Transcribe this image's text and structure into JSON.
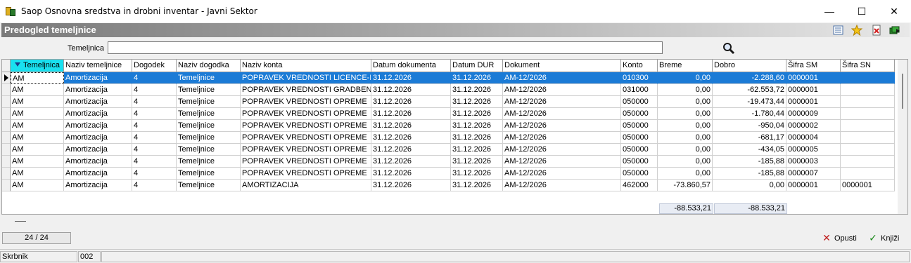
{
  "window": {
    "title": "Saop Osnovna sredstva in drobni inventar - Javni Sektor",
    "minimize": "—",
    "maximize": "☐",
    "close": "✕"
  },
  "header": {
    "title": "Predogled temeljnice",
    "icons": [
      "list-settings-icon",
      "favorite-star-icon",
      "delete-document-icon",
      "export-books-icon"
    ]
  },
  "search": {
    "label": "Temeljnica",
    "value": "",
    "icon": "search-icon"
  },
  "grid": {
    "columns": [
      "Temeljnica",
      "Naziv temeljnice",
      "Dogodek",
      "Naziv dogodka",
      "Naziv konta",
      "Datum dokumenta",
      "Datum DUR",
      "Dokument",
      "Konto",
      "Breme",
      "Dobro",
      "Šifra SM",
      "Šifra SN"
    ],
    "sorted_column": "Temeljnica",
    "rows": [
      [
        "AM",
        "Amortizacija",
        "4",
        "Temeljnice",
        "POPRAVEK VREDNOSTI LICENCE-Prog",
        "31.12.2026",
        "31.12.2026",
        "AM-12/2026",
        "010300",
        "0,00",
        "-2.288,60",
        "0000001",
        ""
      ],
      [
        "AM",
        "Amortizacija",
        "4",
        "Temeljnice",
        "POPRAVEK VREDNOSTI GRADBENIH O",
        "31.12.2026",
        "31.12.2026",
        "AM-12/2026",
        "031000",
        "0,00",
        "-62.553,72",
        "0000001",
        ""
      ],
      [
        "AM",
        "Amortizacija",
        "4",
        "Temeljnice",
        "POPRAVEK VREDNOSTI OPREME",
        "31.12.2026",
        "31.12.2026",
        "AM-12/2026",
        "050000",
        "0,00",
        "-19.473,44",
        "0000001",
        ""
      ],
      [
        "AM",
        "Amortizacija",
        "4",
        "Temeljnice",
        "POPRAVEK VREDNOSTI OPREME",
        "31.12.2026",
        "31.12.2026",
        "AM-12/2026",
        "050000",
        "0,00",
        "-1.780,44",
        "0000009",
        ""
      ],
      [
        "AM",
        "Amortizacija",
        "4",
        "Temeljnice",
        "POPRAVEK VREDNOSTI OPREME",
        "31.12.2026",
        "31.12.2026",
        "AM-12/2026",
        "050000",
        "0,00",
        "-950,04",
        "0000002",
        ""
      ],
      [
        "AM",
        "Amortizacija",
        "4",
        "Temeljnice",
        "POPRAVEK VREDNOSTI OPREME",
        "31.12.2026",
        "31.12.2026",
        "AM-12/2026",
        "050000",
        "0,00",
        "-681,17",
        "0000004",
        ""
      ],
      [
        "AM",
        "Amortizacija",
        "4",
        "Temeljnice",
        "POPRAVEK VREDNOSTI OPREME",
        "31.12.2026",
        "31.12.2026",
        "AM-12/2026",
        "050000",
        "0,00",
        "-434,05",
        "0000005",
        ""
      ],
      [
        "AM",
        "Amortizacija",
        "4",
        "Temeljnice",
        "POPRAVEK VREDNOSTI OPREME",
        "31.12.2026",
        "31.12.2026",
        "AM-12/2026",
        "050000",
        "0,00",
        "-185,88",
        "0000003",
        ""
      ],
      [
        "AM",
        "Amortizacija",
        "4",
        "Temeljnice",
        "POPRAVEK VREDNOSTI OPREME",
        "31.12.2026",
        "31.12.2026",
        "AM-12/2026",
        "050000",
        "0,00",
        "-185,88",
        "0000007",
        ""
      ],
      [
        "AM",
        "Amortizacija",
        "4",
        "Temeljnice",
        "AMORTIZACIJA",
        "31.12.2026",
        "31.12.2026",
        "AM-12/2026",
        "462000",
        "-73.860,57",
        "0,00",
        "0000001",
        "0000001"
      ]
    ],
    "totals": {
      "breme": "-88.533,21",
      "dobro": "-88.533,21"
    }
  },
  "footer": {
    "counter": "24 / 24",
    "cancel_label": "Opusti",
    "post_label": "Knjiži"
  },
  "statusbar": {
    "user": "Skrbnik",
    "code": "002"
  }
}
